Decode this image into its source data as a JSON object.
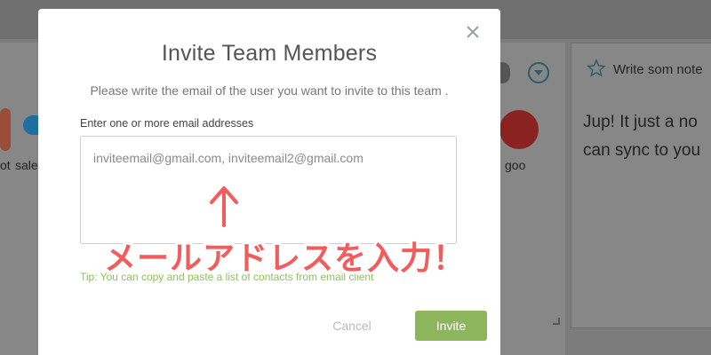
{
  "background": {
    "left_labels": [
      "ot",
      "sale",
      "goo"
    ],
    "note_placeholder": "Write som note",
    "note_body_line1": "Jup! It  just a no",
    "note_body_line2": "can sync to you"
  },
  "modal": {
    "title": "Invite Team Members",
    "subtitle": "Please write the email of the user you want to invite to this team .",
    "field_label": "Enter one or more email addresses",
    "email_placeholder": "inviteemail@gmail.com, inviteemail2@gmail.com",
    "tip": "Tip: You can copy and paste a list of contacts from email client",
    "cancel_label": "Cancel",
    "invite_label": "Invite"
  },
  "annotation": {
    "arrow": "↑",
    "text": "メールアドレスを入力！"
  },
  "colors": {
    "accent_green": "#8db55b",
    "tip_green": "#8fc15d",
    "annotation_red": "#f25c5c"
  }
}
